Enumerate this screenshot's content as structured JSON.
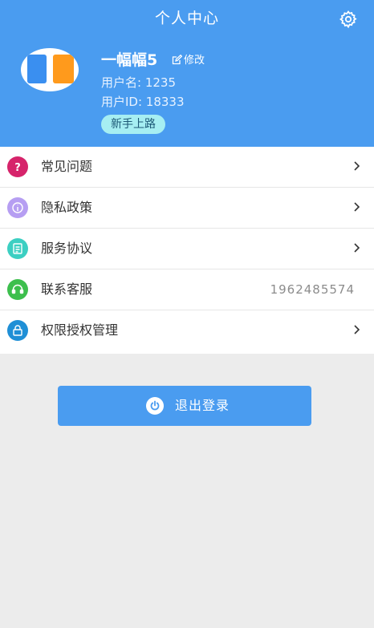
{
  "header": {
    "title": "个人中心",
    "settings_icon": "gear-icon"
  },
  "profile": {
    "nickname": "一幅幅5",
    "edit_label": "修改",
    "username": "用户名: 1235",
    "user_id": "用户ID: 18333",
    "badge": "新手上路"
  },
  "menu": {
    "items": [
      {
        "label": "常见问题",
        "icon": "question-icon",
        "color": "#d6246b"
      },
      {
        "label": "隐私政策",
        "icon": "info-icon",
        "color": "#b69ef2"
      },
      {
        "label": "服务协议",
        "icon": "document-icon",
        "color": "#3ccfc2"
      },
      {
        "label": "联系客服",
        "icon": "headset-icon",
        "color": "#3dbf4d",
        "value": "1962485574"
      },
      {
        "label": "权限授权管理",
        "icon": "lock-icon",
        "color": "#1f8fd6"
      }
    ]
  },
  "logout": {
    "label": "退出登录",
    "icon": "power-icon"
  },
  "colors": {
    "primary": "#4a9cf0",
    "background": "#ececec"
  }
}
